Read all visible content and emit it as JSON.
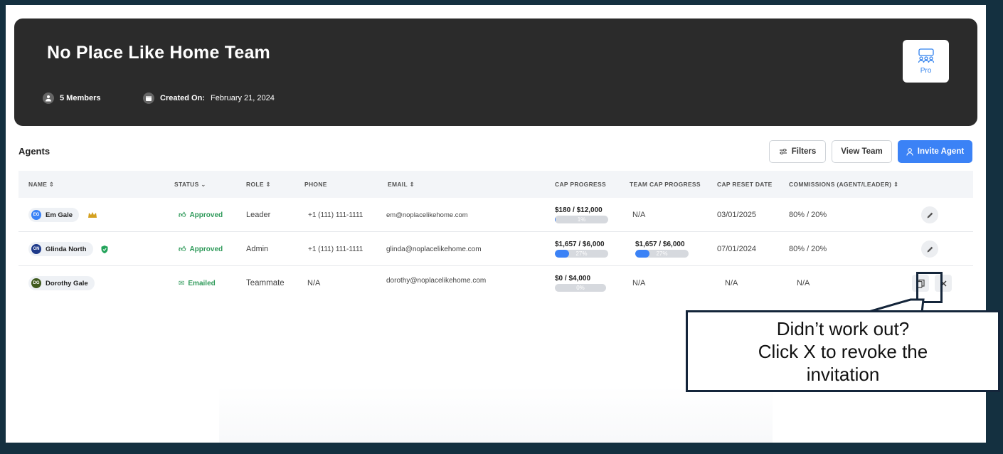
{
  "team": {
    "name": "No Place Like Home Team",
    "members": "5 Members",
    "created_label": "Created On:",
    "created_date": "February 21, 2024",
    "plan": "Pro"
  },
  "agents_section": {
    "title": "Agents",
    "filters_label": "Filters",
    "view_team_label": "View Team",
    "invite_label": "Invite Agent",
    "primary_color": "#3b82f6"
  },
  "columns": {
    "name": "NAME",
    "status": "STATUS",
    "role": "ROLE",
    "phone": "PHONE",
    "email": "EMAIL",
    "cap_progress": "CAP PROGRESS",
    "team_cap_progress": "TEAM CAP PROGRESS",
    "cap_reset_date": "CAP RESET DATE",
    "commissions": "COMMISSIONS (AGENT/LEADER)"
  },
  "rows": [
    {
      "initials": "EG",
      "avatar_color": "#3b82f6",
      "name": "Em Gale",
      "badge_icon": "crown-icon",
      "status": "Approved",
      "status_icon": "thumbs-up-icon",
      "role": "Leader",
      "phone": "+1 (111) 111-1111",
      "email": "em@noplacelikehome.com",
      "cap_text": "$180 / $12,000",
      "cap_pct": "1%",
      "cap_fraction": 0.015,
      "team_cap_text": "N/A",
      "reset_date": "03/01/2025",
      "commissions": "80% / 20%"
    },
    {
      "initials": "GN",
      "avatar_color": "#1e3a8a",
      "name": "Glinda North",
      "badge_icon": "shield-icon",
      "status": "Approved",
      "status_icon": "thumbs-up-icon",
      "role": "Admin",
      "phone": "+1 (111) 111-1111",
      "email": "glinda@noplacelikehome.com",
      "cap_text": "$1,657 / $6,000",
      "cap_pct": "27%",
      "cap_fraction": 0.27,
      "team_cap_text": "$1,657 / $6,000",
      "team_cap_pct": "27%",
      "team_cap_fraction": 0.27,
      "reset_date": "07/01/2024",
      "commissions": "80% / 20%"
    },
    {
      "initials": "DG",
      "avatar_color": "#3f5a1e",
      "name": "Dorothy Gale",
      "status": "Emailed",
      "status_icon": "envelope-open-icon",
      "role": "Teammate",
      "phone": "N/A",
      "email": "dorothy@noplacelikehome.com",
      "cap_text": "$0 / $4,000",
      "cap_pct": "0%",
      "cap_fraction": 0,
      "team_cap_text": "N/A",
      "reset_date": "N/A",
      "commissions": "N/A"
    }
  ],
  "callout": {
    "line1": "Didn’t work out?",
    "line2": "Click X to revoke the",
    "line3": "invitation"
  }
}
